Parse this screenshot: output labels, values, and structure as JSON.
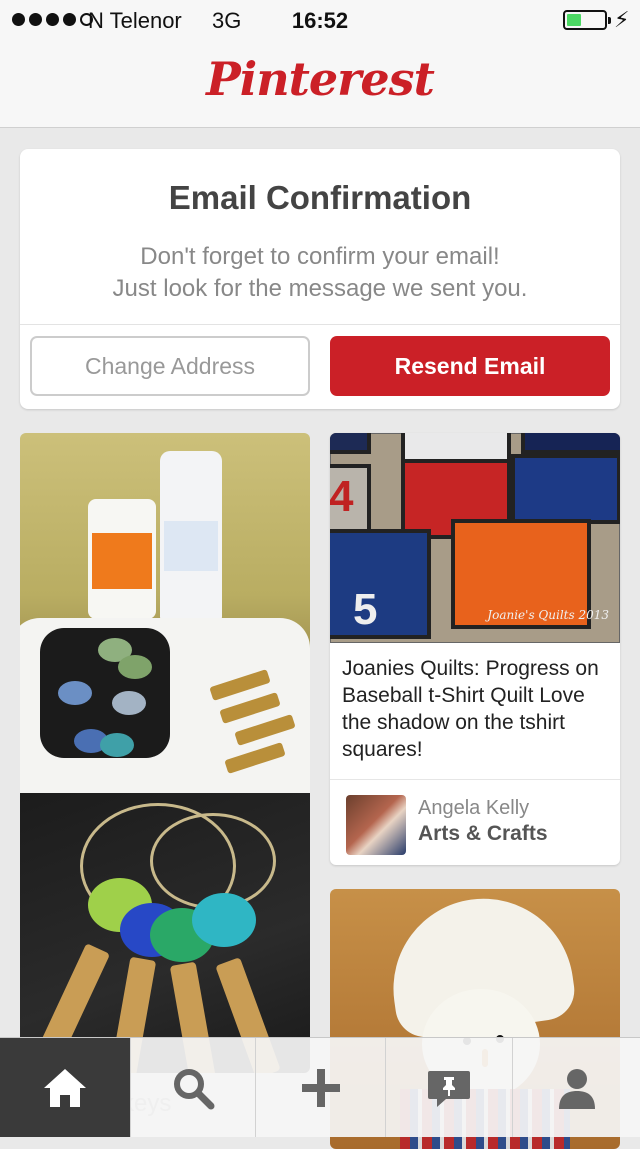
{
  "status_bar": {
    "carrier": "N Telenor",
    "network": "3G",
    "time": "16:52",
    "signal_bars": 4,
    "battery_level": 0.36
  },
  "header": {
    "logo_text": "Pinterest",
    "brand_color": "#cb2027"
  },
  "email_confirmation": {
    "title": "Email Confirmation",
    "message_line1": "Don't forget to confirm your email!",
    "message_line2": "Just look for the message we sent you.",
    "change_address_label": "Change Address",
    "resend_email_label": "Resend Email"
  },
  "pins": [
    {
      "image": "glitter-keys-photo",
      "caption_partial": "keys"
    },
    {
      "image": "baseball-tshirt-quilt-photo",
      "watermark": "Joanie's Quilts 2013",
      "description": "Joanies Quilts: Progress on Baseball t-Shirt Quilt Love the shadow on the tshirt squares!",
      "pinner": "Angela Kelly",
      "board": "Arts & Crafts"
    },
    {
      "image": "sock-snowman-photo"
    }
  ],
  "tab_bar": {
    "tabs": [
      {
        "name": "home",
        "icon": "home-icon",
        "active": true
      },
      {
        "name": "search",
        "icon": "search-icon",
        "active": false
      },
      {
        "name": "add",
        "icon": "plus-icon",
        "active": false
      },
      {
        "name": "news",
        "icon": "news-icon",
        "active": false
      },
      {
        "name": "profile",
        "icon": "profile-icon",
        "active": false
      }
    ]
  }
}
